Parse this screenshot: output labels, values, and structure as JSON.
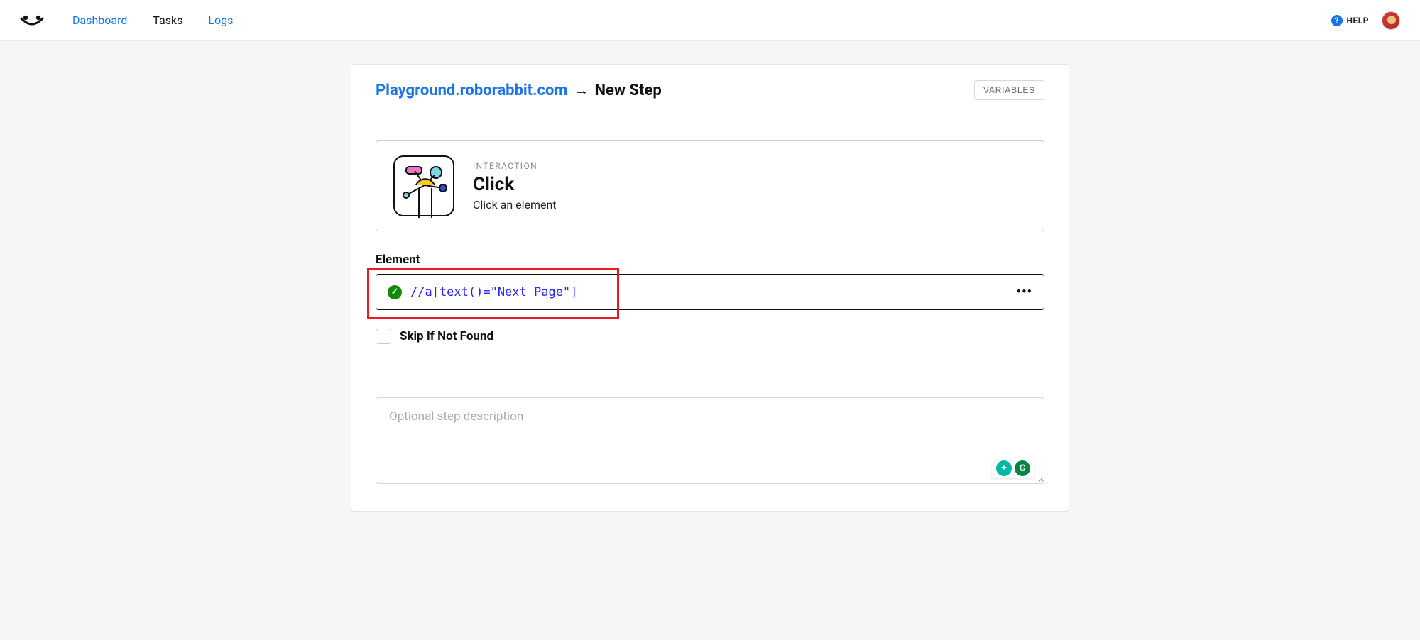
{
  "nav": {
    "items": [
      {
        "label": "Dashboard",
        "active": false
      },
      {
        "label": "Tasks",
        "active": true
      },
      {
        "label": "Logs",
        "active": false
      }
    ],
    "help_label": "HELP"
  },
  "breadcrumb": {
    "link_text": "Playground.roborabbit.com",
    "arrow": "→",
    "current": "New Step"
  },
  "variables_button": "VARIABLES",
  "step_card": {
    "category": "INTERACTION",
    "title": "Click",
    "description": "Click an element"
  },
  "element_section": {
    "label": "Element",
    "xpath_value": "//a[text()=\"Next Page\"]",
    "more": "•••"
  },
  "skip_checkbox": {
    "label": "Skip If Not Found",
    "checked": false
  },
  "description_area": {
    "placeholder": "Optional step description"
  }
}
